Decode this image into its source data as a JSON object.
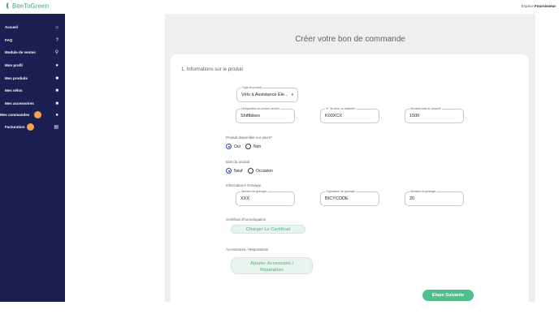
{
  "topbar": {
    "logo": "BeeToGreen",
    "espace_prefix": "Espace",
    "espace_role": "Fournisseur"
  },
  "sidebar": {
    "items": [
      {
        "label": "Accueil",
        "icon": "home-icon"
      },
      {
        "label": "FAQ",
        "icon": "question-icon"
      },
      {
        "label": "Module de ventes",
        "icon": "search-icon"
      },
      {
        "label": "Mon profil",
        "icon": "user-icon"
      },
      {
        "label": "Mes produits",
        "icon": "box-icon"
      },
      {
        "label": "Mes vélos",
        "icon": "box-icon"
      },
      {
        "label": "Mes accessoires",
        "icon": "box-icon"
      },
      {
        "label": "Mes commandes",
        "icon": "info-icon",
        "badge": "orange"
      },
      {
        "label": "Facturation",
        "icon": "card-icon",
        "badge": "orange"
      }
    ]
  },
  "page": {
    "title": "Créer votre bon de commande",
    "section_title": "1. Informations sur le produit"
  },
  "form": {
    "product_type": {
      "label": "Type de produit",
      "value": "Vélo à Assistance Éle..."
    },
    "designation": {
      "label": "Désignation du produit vendu*",
      "value": "Shiftbikes"
    },
    "serial": {
      "label": "N° de série ou batterie*",
      "value": "K00XCX"
    },
    "amount": {
      "label": "Montant total du produit*",
      "value": "1500"
    },
    "available": {
      "label": "Produit disponible sur place*",
      "options": [
        "Oui",
        "Non"
      ],
      "selected": "Oui"
    },
    "state": {
      "label": "Etat du produit",
      "options": [
        "Neuf",
        "Occasion"
      ],
      "selected": "Neuf"
    },
    "engraving_title": "Informations Gravage",
    "engraving_number": {
      "label": "Numéro de gravage",
      "value": "XXX"
    },
    "engraving_org": {
      "label": "Organisme de gravage",
      "value": "BICYCODE"
    },
    "engraving_amount": {
      "label": "Montant du gravage",
      "value": "20"
    },
    "certificate_label": "Certificat d'homologation",
    "certificate_button": "Charger Le Certificat",
    "accessories_label": "Accessoires / Réparations",
    "accessories_button_line1": "Ajouter Accessoire /",
    "accessories_button_line2": "Réparation",
    "next_button": "Etape Suivante"
  },
  "colors": {
    "sidebar": "#1b1f52",
    "accent": "#4ec08f",
    "badge": "#f5a04a"
  }
}
